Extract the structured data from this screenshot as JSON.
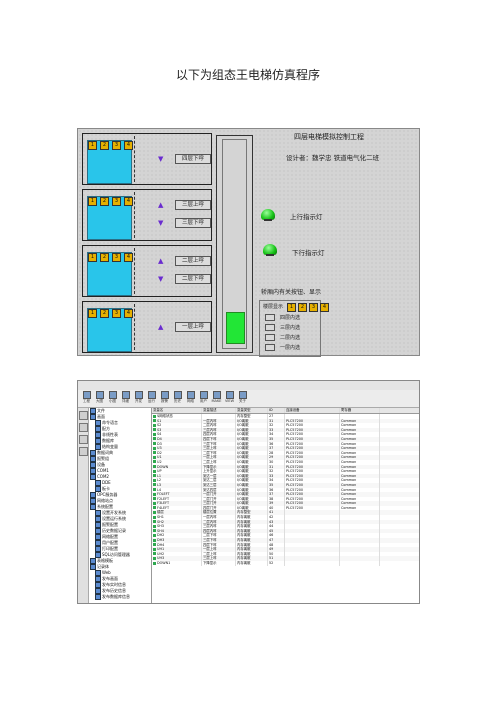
{
  "page_title": "以下为组态王电梯仿真程序",
  "sim": {
    "title": "四层电梯模拟控制工程",
    "designer": "设计者：魏学忠   铁道电气化二班",
    "up_lamp": "上行指示灯",
    "down_lamp": "下行指示灯",
    "inner_note": "轿厢内有关按钮、显示",
    "floor_display": "楼层显示",
    "floor_digits": [
      "1",
      "2",
      "3",
      "4"
    ],
    "inner_options": [
      "四层内选",
      "三层内选",
      "二层内选",
      "一层内选"
    ],
    "floors": [
      {
        "buttons": [
          "1",
          "2",
          "3",
          "4"
        ],
        "calls": [
          {
            "dir": "down",
            "label": "四层下呼"
          }
        ]
      },
      {
        "buttons": [
          "1",
          "2",
          "3",
          "4"
        ],
        "calls": [
          {
            "dir": "up",
            "label": "三层上呼"
          },
          {
            "dir": "down",
            "label": "三层下呼"
          }
        ]
      },
      {
        "buttons": [
          "1",
          "2",
          "3",
          "4"
        ],
        "calls": [
          {
            "dir": "up",
            "label": "二层上呼"
          },
          {
            "dir": "down",
            "label": "二层下呼"
          }
        ]
      },
      {
        "buttons": [
          "1",
          "2",
          "3",
          "4"
        ],
        "calls": [
          {
            "dir": "up",
            "label": "一层上呼"
          }
        ]
      }
    ],
    "car_floor": 1
  },
  "cfg": {
    "toolbar": [
      "工程",
      "大图",
      "小图",
      "详细",
      "开发",
      "运行",
      "报警",
      "历史",
      "网络",
      "用户",
      "MAKE",
      "VIEW",
      "关于"
    ],
    "tree": [
      "文件",
      "画面",
      "命令语言",
      "配方",
      "非线性表",
      "数据库",
      "结构变量",
      "数据词典",
      "报警组",
      "设备",
      "COM1",
      "COM2",
      "DDE",
      "板卡",
      "OPC服务器",
      "网络站点",
      "系统配置",
      "设置开发系统",
      "设置运行系统",
      "报警配置",
      "历史数据记录",
      "网络配置",
      "用户配置",
      "打印配置",
      "SQL访问管理器",
      "表格模板",
      "记录体",
      "Web",
      "发布画面",
      "发布实时信息",
      "发布历史信息",
      "发布数据库信息"
    ],
    "columns": [
      "变量名",
      "变量描述",
      "变量类型",
      "ID",
      "连接设备",
      "寄存器"
    ],
    "rows": [
      [
        "$网络状态",
        "",
        "内存整型",
        "27",
        "",
        ""
      ],
      [
        "S1",
        "一层内呼",
        "I/O离散",
        "31",
        "PLC57200",
        "Common"
      ],
      [
        "S2",
        "二层内呼",
        "I/O离散",
        "32",
        "PLC57200",
        "Common"
      ],
      [
        "S3",
        "三层内呼",
        "I/O离散",
        "33",
        "PLC57200",
        "Common"
      ],
      [
        "S4",
        "四层内呼",
        "I/O离散",
        "34",
        "PLC57200",
        "Common"
      ],
      [
        "D4",
        "四层下呼",
        "I/O离散",
        "35",
        "PLC57200",
        "Common"
      ],
      [
        "D3",
        "三层下呼",
        "I/O离散",
        "36",
        "PLC57200",
        "Common"
      ],
      [
        "U3",
        "三层上呼",
        "I/O离散",
        "37",
        "PLC57200",
        "Common"
      ],
      [
        "D2",
        "二层下呼",
        "I/O离散",
        "28",
        "PLC57200",
        "Common"
      ],
      [
        "U1",
        "一层上呼",
        "I/O离散",
        "29",
        "PLC57200",
        "Common"
      ],
      [
        "U2",
        "二层上呼",
        "I/O离散",
        "30",
        "PLC57200",
        "Common"
      ],
      [
        "DOWN",
        "下降显示",
        "I/O离散",
        "31",
        "PLC57200",
        "Common"
      ],
      [
        "UP",
        "上升显示",
        "I/O离散",
        "32",
        "PLC57200",
        "Common"
      ],
      [
        "L1",
        "到达一层",
        "I/O离散",
        "33",
        "PLC57200",
        "Common"
      ],
      [
        "L2",
        "到达二层",
        "I/O离散",
        "34",
        "PLC57200",
        "Common"
      ],
      [
        "L3",
        "到达三层",
        "I/O离散",
        "35",
        "PLC57200",
        "Common"
      ],
      [
        "L4",
        "到达四层",
        "I/O离散",
        "36",
        "PLC57200",
        "Common"
      ],
      [
        "FOLEFT",
        "一层门开",
        "I/O离散",
        "37",
        "PLC57200",
        "Common"
      ],
      [
        "F2LEFT",
        "二层门开",
        "I/O离散",
        "38",
        "PLC57200",
        "Common"
      ],
      [
        "F3LEFT",
        "三层门开",
        "I/O离散",
        "39",
        "PLC57200",
        "Common"
      ],
      [
        "F4LEFT",
        "四层门开",
        "I/O离散",
        "40",
        "PLC57200",
        "Common"
      ],
      [
        "楼层",
        "楼层位置",
        "内存整型",
        "41",
        "",
        ""
      ],
      [
        "SH1",
        "一层内呼",
        "内存离散",
        "42",
        "",
        ""
      ],
      [
        "SH2",
        "二层内呼",
        "内存离散",
        "43",
        "",
        ""
      ],
      [
        "SH3",
        "三层内呼",
        "内存离散",
        "44",
        "",
        ""
      ],
      [
        "SH4",
        "四层内呼",
        "内存离散",
        "45",
        "",
        ""
      ],
      [
        "DH2",
        "二层下呼",
        "内存离散",
        "46",
        "",
        ""
      ],
      [
        "DH3",
        "三层下呼",
        "内存离散",
        "47",
        "",
        ""
      ],
      [
        "DH4",
        "四层下呼",
        "内存离散",
        "48",
        "",
        ""
      ],
      [
        "UH1",
        "一层上呼",
        "内存离散",
        "49",
        "",
        ""
      ],
      [
        "UH2",
        "二层上呼",
        "内存离散",
        "50",
        "",
        ""
      ],
      [
        "UH3",
        "三层上呼",
        "内存离散",
        "51",
        "",
        ""
      ],
      [
        "DOWN1",
        "下降显示",
        "内存离散",
        "52",
        "",
        ""
      ]
    ]
  }
}
